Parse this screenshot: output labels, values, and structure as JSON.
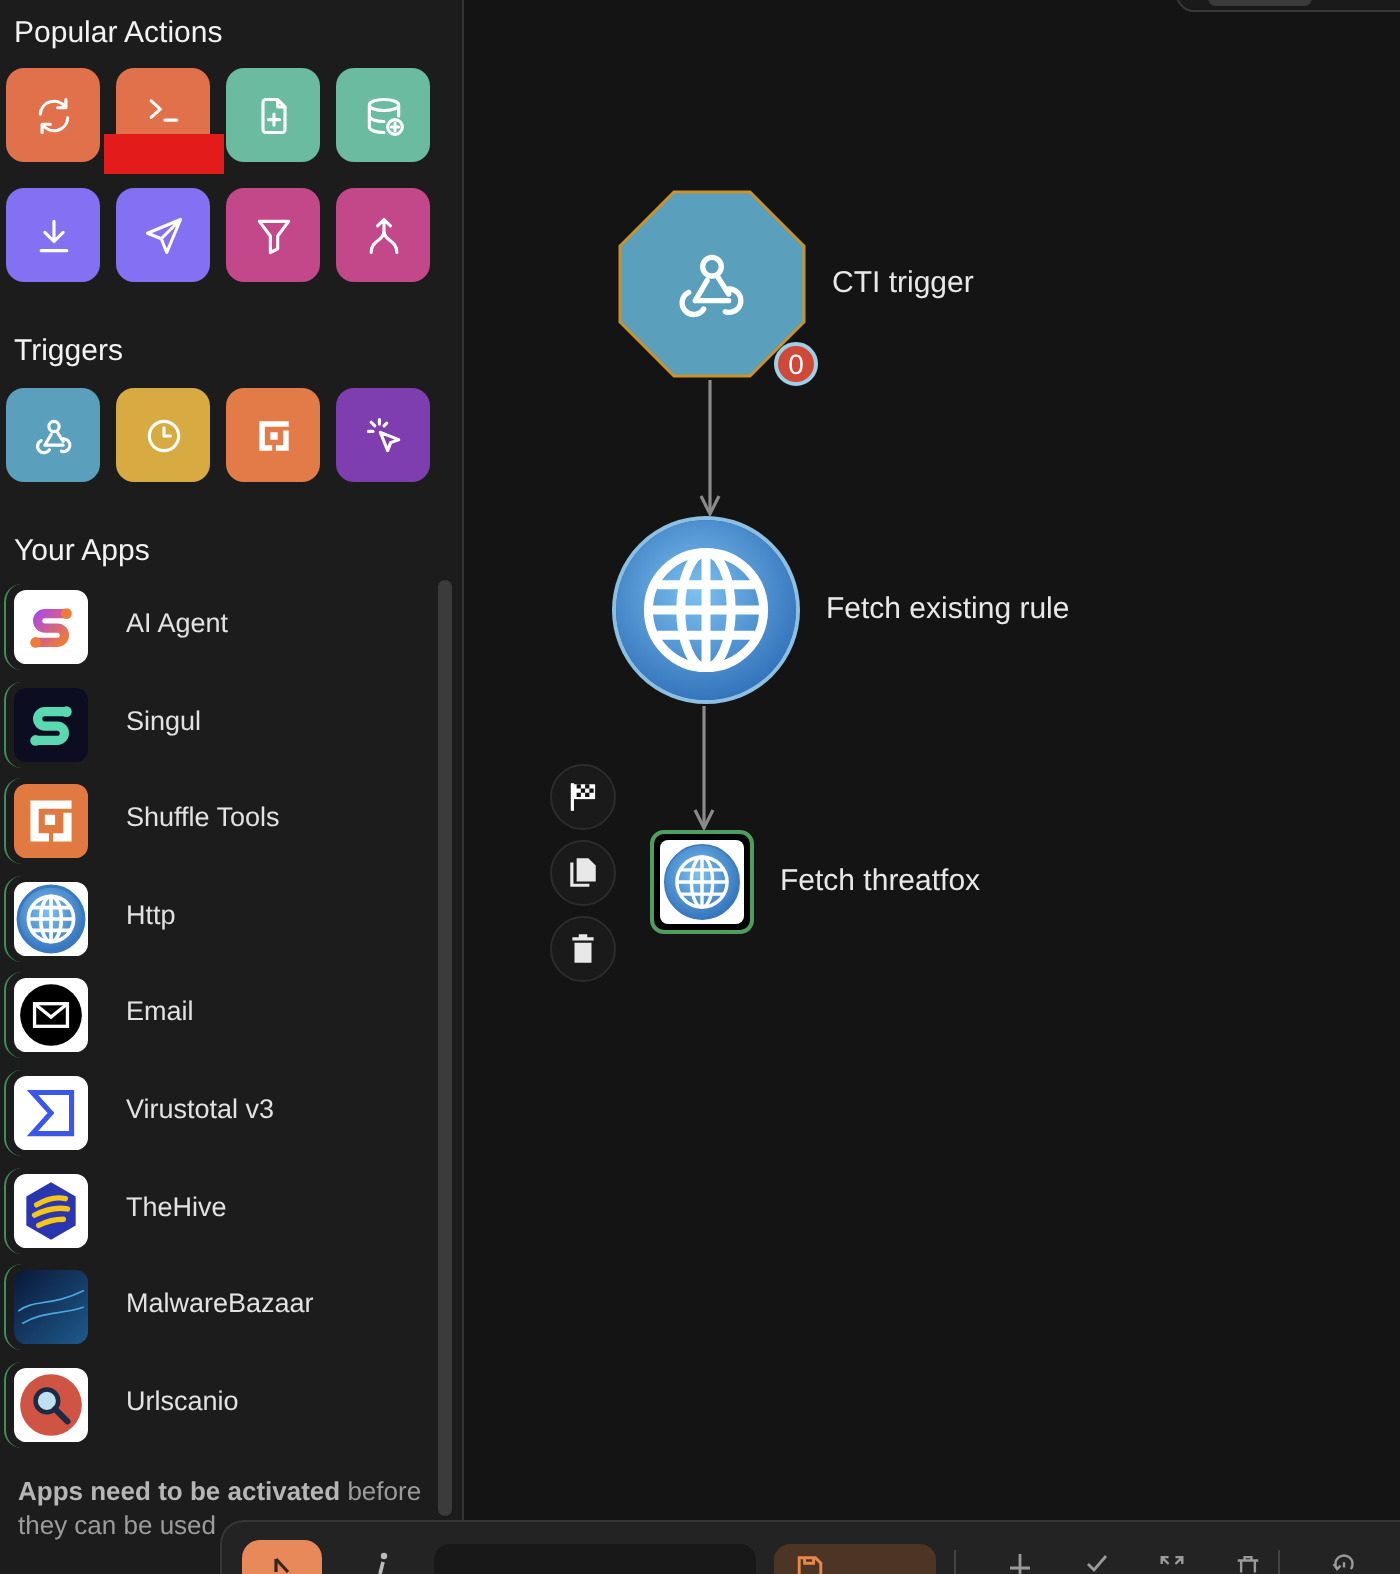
{
  "sidebar": {
    "popular_actions": {
      "title": "Popular Actions",
      "items": [
        {
          "color": "#e0714a",
          "redacted": false
        },
        {
          "color": "#e0714a",
          "redacted": true
        },
        {
          "color": "#6bbba0",
          "redacted": false
        },
        {
          "color": "#6bbba0",
          "redacted": false
        },
        {
          "color": "#8470f2",
          "redacted": false
        },
        {
          "color": "#8470f2",
          "redacted": false
        },
        {
          "color": "#c2488a",
          "redacted": false
        },
        {
          "color": "#c2488a",
          "redacted": false
        }
      ]
    },
    "triggers": {
      "title": "Triggers",
      "items": [
        {
          "color": "#5a9fbb"
        },
        {
          "color": "#d8aa42"
        },
        {
          "color": "#e37b48"
        },
        {
          "color": "#7e3eb0"
        }
      ]
    },
    "apps": {
      "title": "Your Apps",
      "items": [
        {
          "name": "AI Agent"
        },
        {
          "name": "Singul"
        },
        {
          "name": "Shuffle Tools"
        },
        {
          "name": "Http"
        },
        {
          "name": "Email"
        },
        {
          "name": "Virustotal v3"
        },
        {
          "name": "TheHive"
        },
        {
          "name": "MalwareBazaar"
        },
        {
          "name": "Urlscanio"
        }
      ]
    },
    "note": "**Apps need to be activated** before they can be used"
  },
  "canvas": {
    "nodes": [
      {
        "kind": "trigger",
        "label": "CTI trigger",
        "badge": "0",
        "linked": false,
        "selected": false
      },
      {
        "kind": "action",
        "label": "Fetch existing rule",
        "linked": true,
        "selected": false
      },
      {
        "kind": "action",
        "label": "Fetch threatfox",
        "linked": true,
        "selected": true
      }
    ]
  }
}
